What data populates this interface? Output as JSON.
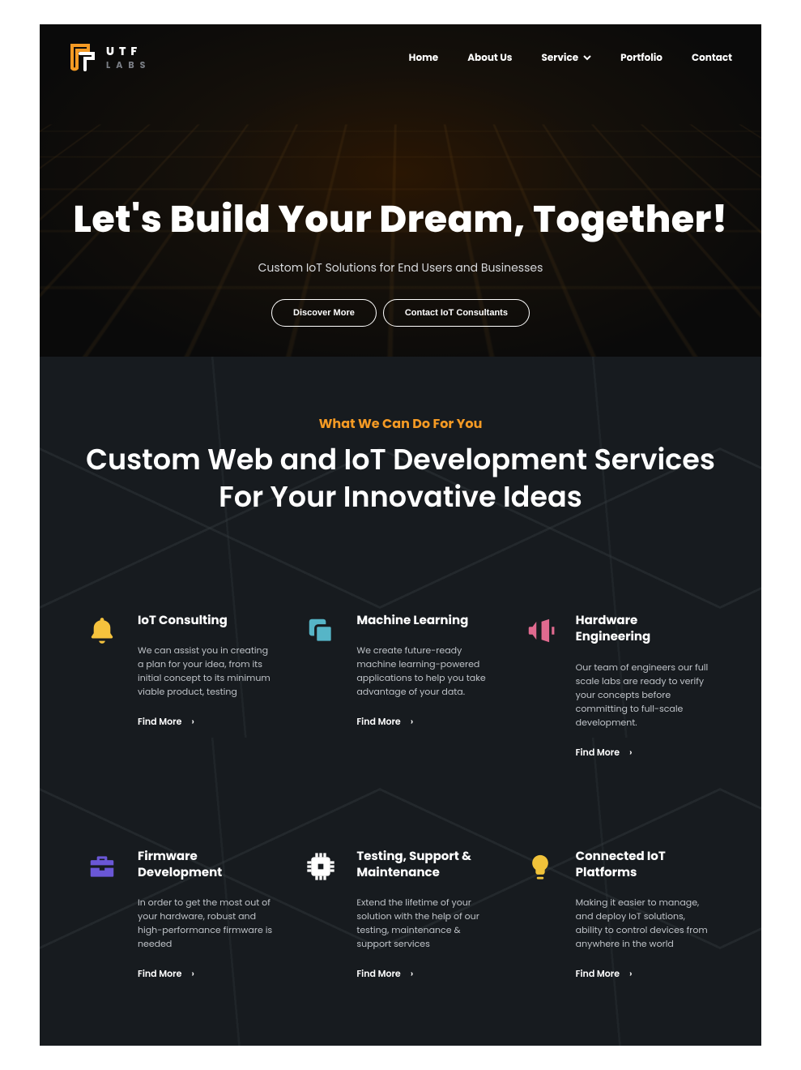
{
  "brand": {
    "name": "UTF",
    "sub": "LABS"
  },
  "nav": {
    "items": [
      {
        "label": "Home",
        "has_chevron": false
      },
      {
        "label": "About Us",
        "has_chevron": false
      },
      {
        "label": "Service",
        "has_chevron": true
      },
      {
        "label": "Portfolio",
        "has_chevron": false
      },
      {
        "label": "Contact",
        "has_chevron": false
      }
    ]
  },
  "hero": {
    "headline": "Let's Build Your Dream, Together!",
    "subhead": "Custom IoT Solutions for End Users and Businesses",
    "cta_primary": "Discover More",
    "cta_secondary": "Contact IoT Consultants"
  },
  "services": {
    "eyebrow": "What We Can Do For You",
    "heading": "Custom Web and IoT Development Services For Your Innovative Ideas",
    "find_label": "Find More",
    "cards": [
      {
        "icon": "bell",
        "title": "IoT Consulting",
        "desc": "We can assist you in creating a plan for your idea, from its initial concept to its minimum viable product, testing"
      },
      {
        "icon": "copy",
        "title": "Machine Learning",
        "desc": "We create future-ready machine learning-powered applications to help you take advantage of your data."
      },
      {
        "icon": "megaphone",
        "title": "Hardware Engineering",
        "desc": "Our team of engineers our full scale labs are ready to verify your concepts before committing to full-scale development."
      },
      {
        "icon": "briefcase",
        "title": "Firmware Development",
        "desc": "In order to get the most out of your hardware, robust and high-performance firmware is needed"
      },
      {
        "icon": "cpu",
        "title": "Testing, Support & Maintenance",
        "desc": "Extend the lifetime of your solution with the help of our testing, maintenance & support services"
      },
      {
        "icon": "bulb",
        "title": "Connected IoT Platforms",
        "desc": "Making it easier to manage, and deploy IoT solutions, ability to control devices from anywhere in the world"
      }
    ]
  },
  "colors": {
    "accent": "#f49a24",
    "icon_yellow": "#f5c23d",
    "icon_teal": "#56b5c7",
    "icon_pink": "#e06a8f",
    "icon_purple": "#6a57d6",
    "icon_white": "#ffffff",
    "icon_amber": "#f0c23a"
  }
}
